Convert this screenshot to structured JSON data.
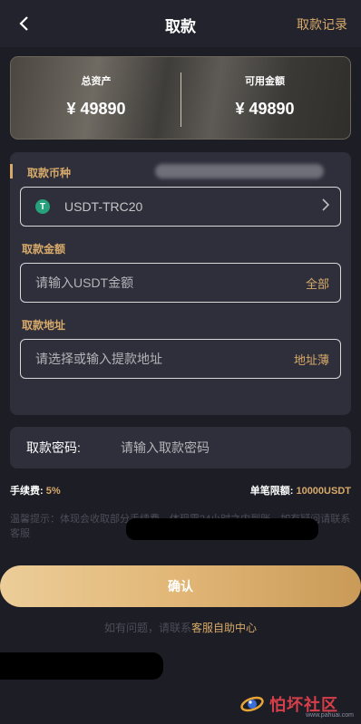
{
  "header": {
    "title": "取款",
    "records_label": "取款记录"
  },
  "balance": {
    "total_label": "总资产",
    "total_value": "¥ 49890",
    "available_label": "可用金额",
    "available_value": "¥ 49890"
  },
  "form": {
    "currency_label": "取款币种",
    "currency_value": "USDT-TRC20",
    "currency_icon_glyph": "T",
    "amount_label": "取款金额",
    "amount_placeholder": "请输入USDT金额",
    "amount_all": "全部",
    "address_label": "取款地址",
    "address_placeholder": "请选择或输入提款地址",
    "address_book": "地址薄"
  },
  "password": {
    "label": "取款密码:",
    "placeholder": "请输入取款密码"
  },
  "fee": {
    "fee_label": "手续费:",
    "fee_value": "5%",
    "limit_label": "单笔限额:",
    "limit_value": "10000USDT"
  },
  "tip": {
    "text": "温馨提示：体现会收取部分手续费，体现需24小时之内到账，如有疑问请联系客服"
  },
  "confirm_label": "确认",
  "help": {
    "prefix": "如有问题，请联系",
    "link": "客服自助中心"
  },
  "watermark": {
    "text": "怕坏社区",
    "sub": "www.pahuai.com"
  },
  "colors": {
    "accent": "#d8aa6a",
    "background": "#1c1d25",
    "card": "#2e2f3b",
    "usdt": "#26a17b"
  }
}
